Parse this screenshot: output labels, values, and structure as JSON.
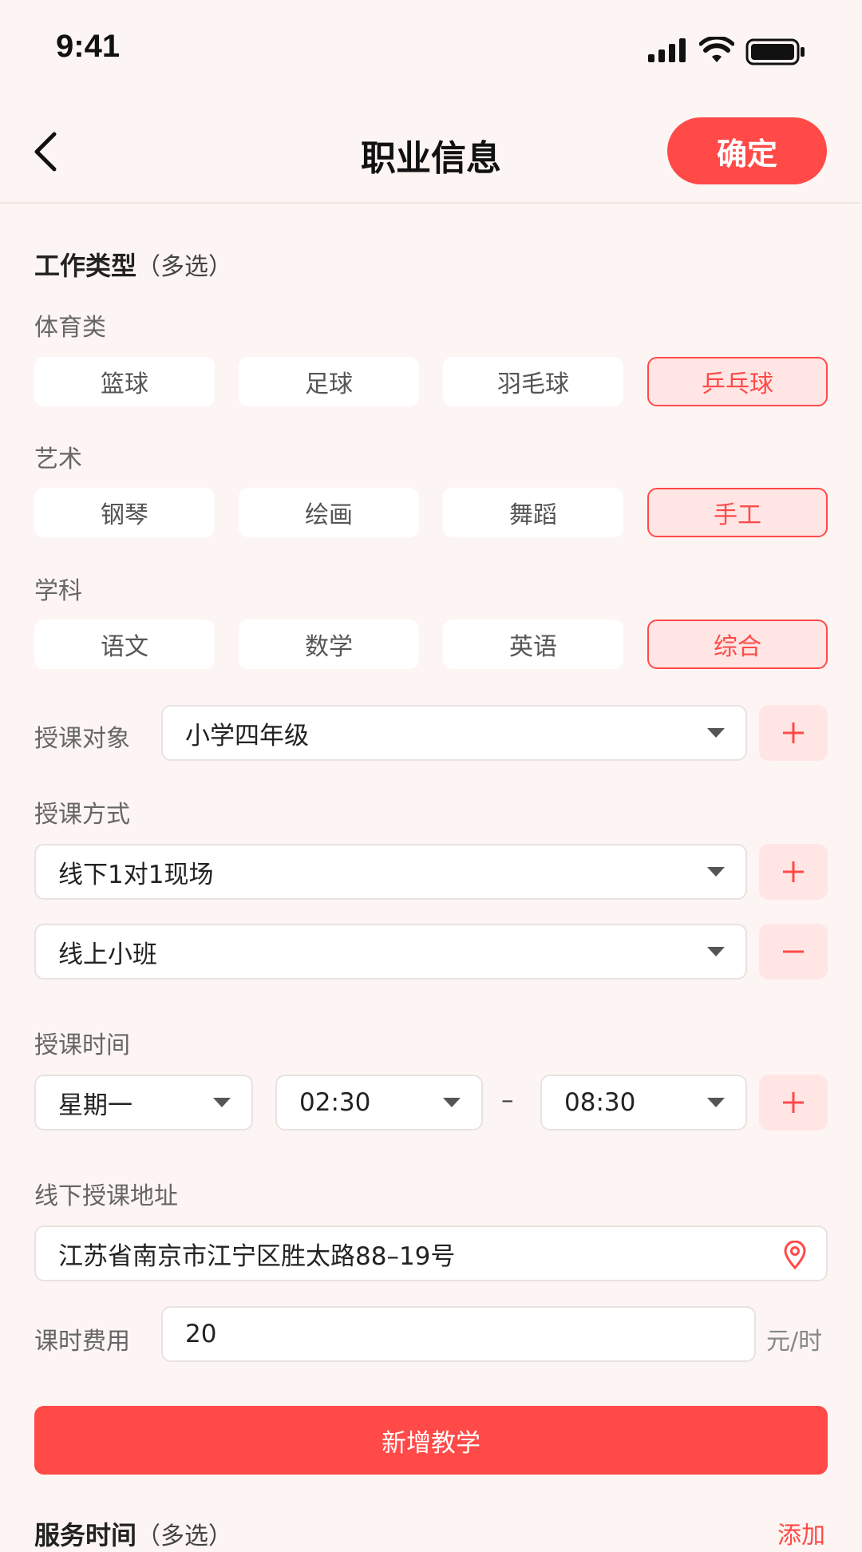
{
  "status_bar": {
    "time": "9:41"
  },
  "header": {
    "title": "职业信息",
    "confirm_label": "确定"
  },
  "work_type": {
    "title": "工作类型",
    "sub": "（多选）",
    "groups": [
      {
        "label": "体育类",
        "options": [
          "篮球",
          "足球",
          "羽毛球",
          "乒乓球"
        ],
        "selected": "乒乓球"
      },
      {
        "label": "艺术",
        "options": [
          "钢琴",
          "绘画",
          "舞蹈",
          "手工"
        ],
        "selected": "手工"
      },
      {
        "label": "学科",
        "options": [
          "语文",
          "数学",
          "英语",
          "综合"
        ],
        "selected": "综合"
      }
    ]
  },
  "target": {
    "label": "授课对象",
    "value": "小学四年级"
  },
  "method": {
    "label": "授课方式",
    "values": [
      "线下1对1现场",
      "线上小班"
    ]
  },
  "time": {
    "label": "授课时间",
    "day": "星期一",
    "start": "02:30",
    "separator": "–",
    "end": "08:30"
  },
  "address": {
    "label": "线下授课地址",
    "value": "江苏省南京市江宁区胜太路88–19号"
  },
  "fee": {
    "label": "课时费用",
    "value": "20",
    "unit": "元/时"
  },
  "add_teaching_label": "新增教学",
  "service_time": {
    "title": "服务时间",
    "sub": "（多选）",
    "add_label": "添加"
  },
  "colors": {
    "accent": "#FF4A48",
    "accent_light": "#FFE6E5",
    "background": "#FDF5F3"
  },
  "icons": [
    "signal-icon",
    "wifi-icon",
    "battery-icon",
    "back-icon",
    "caret-down-icon",
    "plus-icon",
    "minus-icon",
    "location-pin-icon"
  ]
}
